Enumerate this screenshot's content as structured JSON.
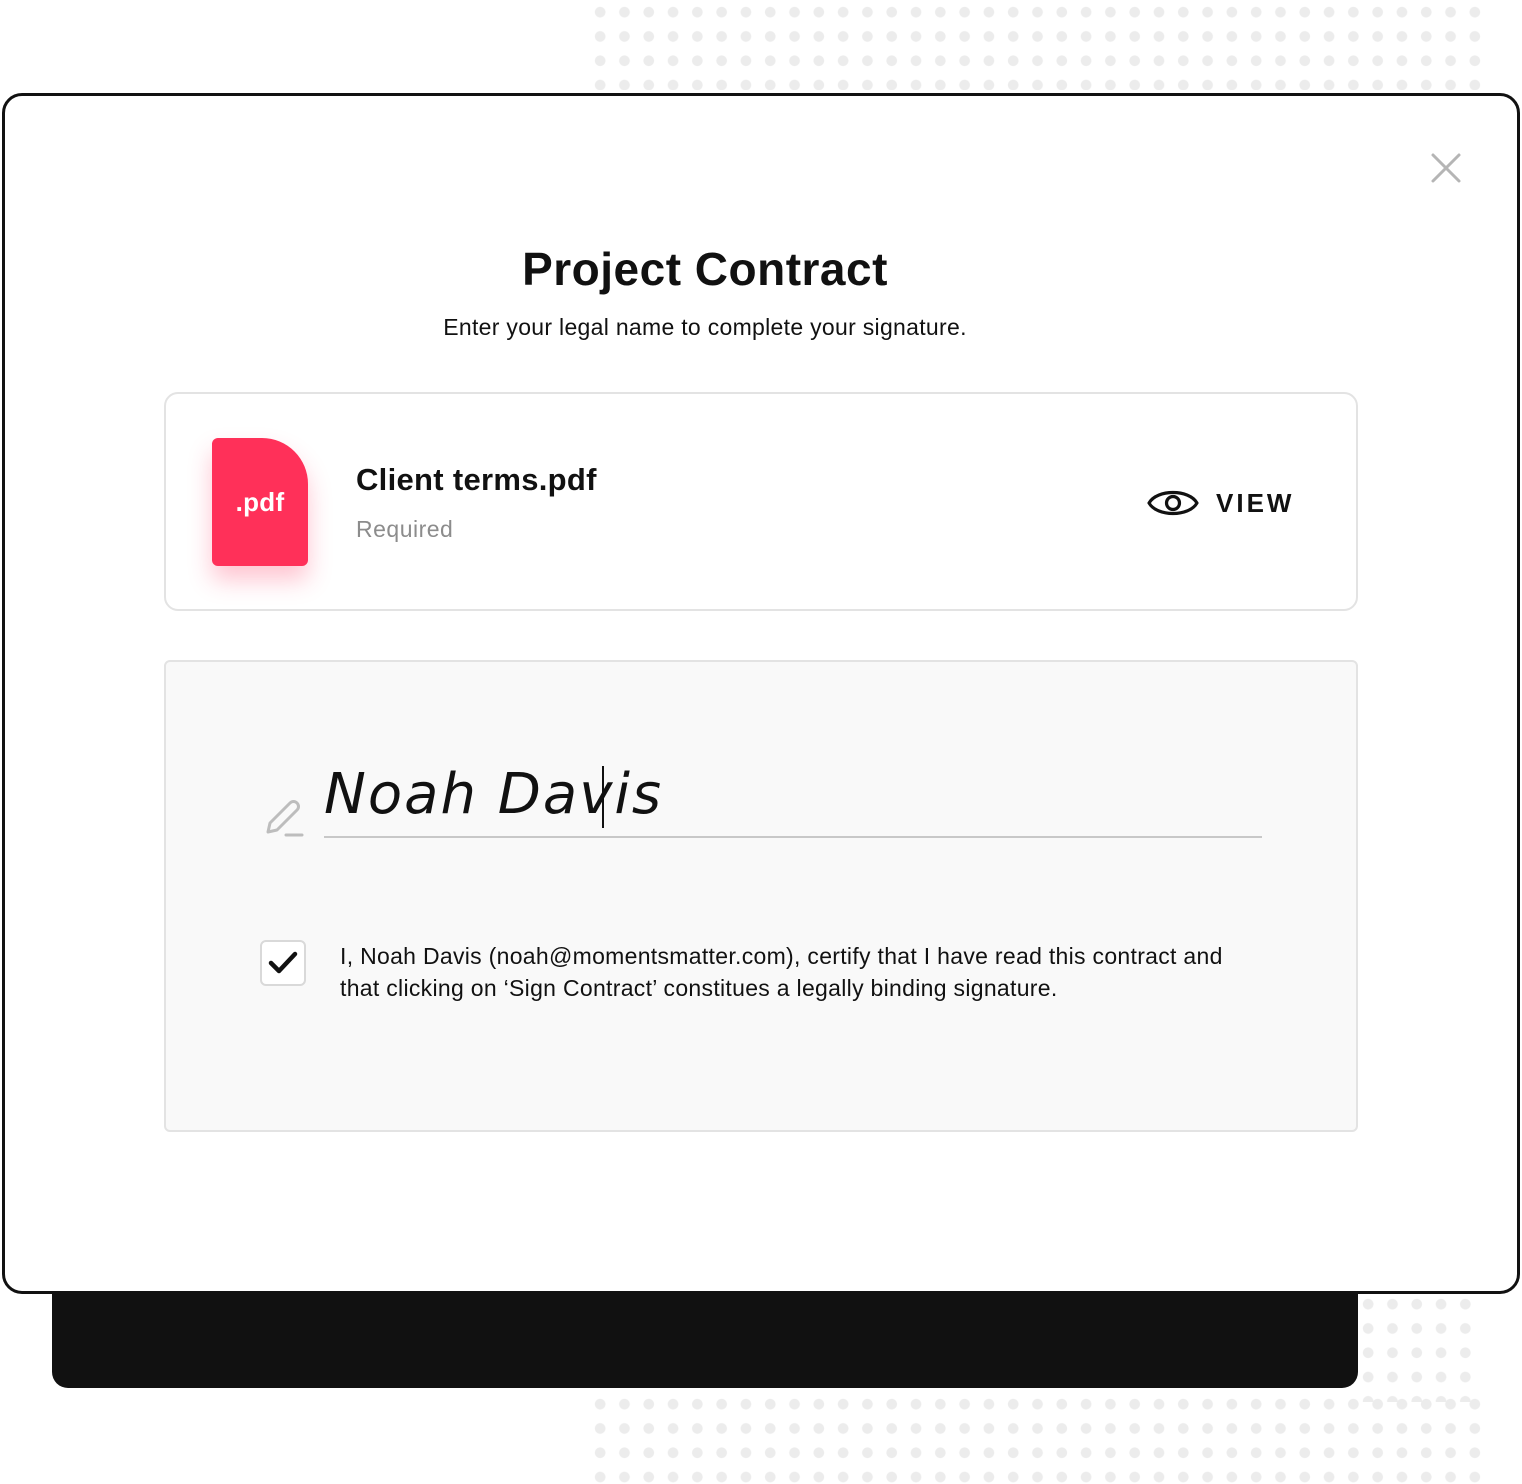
{
  "modal": {
    "title": "Project Contract",
    "subtitle": "Enter your legal name to complete your signature."
  },
  "document": {
    "file_type_label": ".pdf",
    "name": "Client terms.pdf",
    "status": "Required",
    "view_label": "VIEW"
  },
  "signature": {
    "value": "Noah Davis",
    "placeholder": ""
  },
  "consent": {
    "checked": true,
    "text": "I, Noah Davis (noah@momentsmatter.com), certify that I have read this contract and that clicking on ‘Sign Contract’ constitues a legally binding signature."
  },
  "icons": {
    "close": "close-icon",
    "view": "eye-icon",
    "pen": "pen-icon",
    "check": "checkmark-icon"
  },
  "colors": {
    "accent": "#ff3059",
    "dark": "#111111",
    "panel_bg": "#f9f9f9",
    "border": "#e3e3e3",
    "muted_text": "#8c8c8c"
  }
}
